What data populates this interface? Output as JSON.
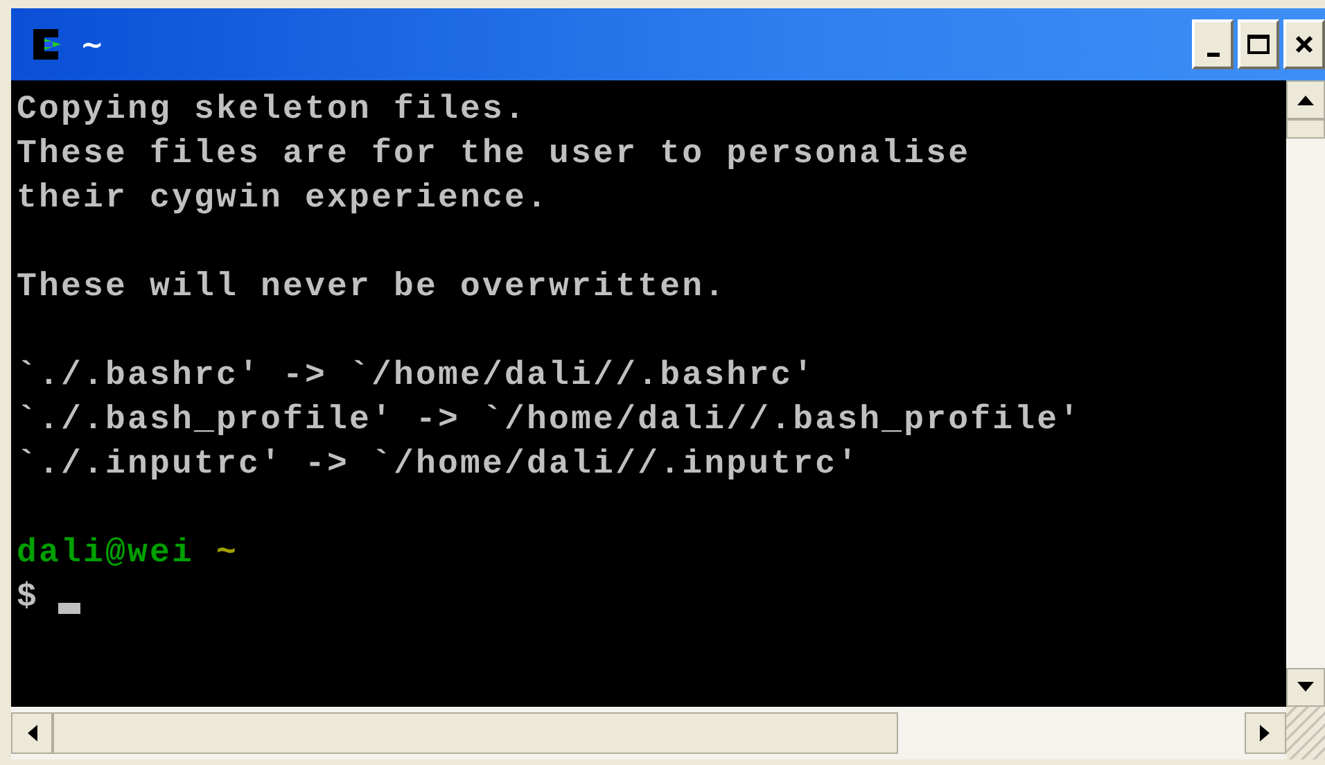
{
  "window": {
    "title": "~"
  },
  "terminal": {
    "lines": [
      {
        "kind": "text",
        "segments": [
          {
            "text": "Copying skeleton files.",
            "color": "#c0c0c0"
          }
        ]
      },
      {
        "kind": "text",
        "segments": [
          {
            "text": "These files are for the user to personalise",
            "color": "#c0c0c0"
          }
        ]
      },
      {
        "kind": "text",
        "segments": [
          {
            "text": "their cygwin experience.",
            "color": "#c0c0c0"
          }
        ]
      },
      {
        "kind": "blank"
      },
      {
        "kind": "text",
        "segments": [
          {
            "text": "These will never be overwritten.",
            "color": "#c0c0c0"
          }
        ]
      },
      {
        "kind": "blank"
      },
      {
        "kind": "text",
        "segments": [
          {
            "text": "`./.bashrc' -> `/home/dali//.bashrc'",
            "color": "#c0c0c0"
          }
        ]
      },
      {
        "kind": "text",
        "segments": [
          {
            "text": "`./.bash_profile' -> `/home/dali//.bash_profile'",
            "color": "#c0c0c0"
          }
        ]
      },
      {
        "kind": "text",
        "segments": [
          {
            "text": "`./.inputrc' -> `/home/dali//.inputrc'",
            "color": "#c0c0c0"
          }
        ]
      },
      {
        "kind": "blank"
      },
      {
        "kind": "text",
        "segments": [
          {
            "text": "dali@wei",
            "color": "#00a000"
          },
          {
            "text": "~",
            "color": "#a0a000"
          }
        ]
      },
      {
        "kind": "input",
        "prompt": "$",
        "cursor": true
      }
    ]
  }
}
